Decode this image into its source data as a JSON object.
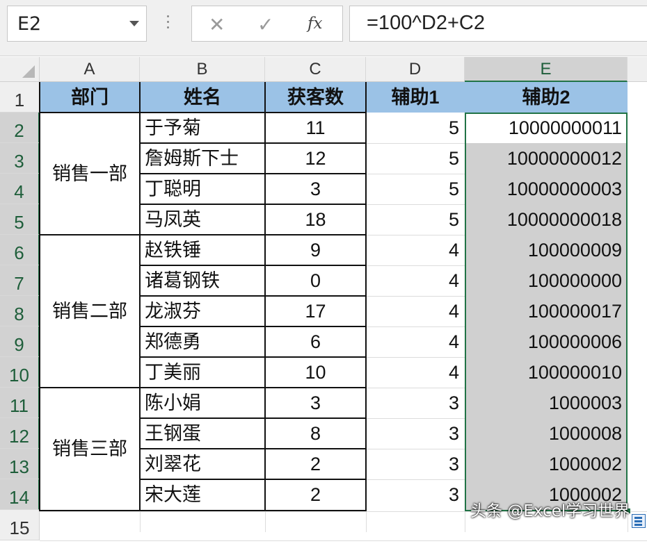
{
  "formula_bar": {
    "name_box": "E2",
    "cancel_icon": "✕",
    "confirm_icon": "✓",
    "fx_label": "fx",
    "formula": "=100^D2+C2"
  },
  "columns": [
    "A",
    "B",
    "C",
    "D",
    "E"
  ],
  "rows": [
    "1",
    "2",
    "3",
    "4",
    "5",
    "6",
    "7",
    "8",
    "9",
    "10",
    "11",
    "12",
    "13",
    "14",
    "15"
  ],
  "selected_cell": "E2",
  "headers": {
    "dept": "部门",
    "name": "姓名",
    "count": "获客数",
    "helper1": "辅助1",
    "helper2": "辅助2"
  },
  "departments": [
    "销售一部",
    "销售二部",
    "销售三部"
  ],
  "records": [
    {
      "name": "于予菊",
      "count": "11",
      "helper1": "5",
      "helper2": "10000000011"
    },
    {
      "name": "詹姆斯下士",
      "count": "12",
      "helper1": "5",
      "helper2": "10000000012"
    },
    {
      "name": "丁聪明",
      "count": "3",
      "helper1": "5",
      "helper2": "10000000003"
    },
    {
      "name": "马凤英",
      "count": "18",
      "helper1": "5",
      "helper2": "10000000018"
    },
    {
      "name": "赵铁锤",
      "count": "9",
      "helper1": "4",
      "helper2": "100000009"
    },
    {
      "name": "诸葛钢铁",
      "count": "0",
      "helper1": "4",
      "helper2": "100000000"
    },
    {
      "name": "龙淑芬",
      "count": "17",
      "helper1": "4",
      "helper2": "100000017"
    },
    {
      "name": "郑德勇",
      "count": "6",
      "helper1": "4",
      "helper2": "100000006"
    },
    {
      "name": "丁美丽",
      "count": "10",
      "helper1": "4",
      "helper2": "100000010"
    },
    {
      "name": "陈小娟",
      "count": "3",
      "helper1": "3",
      "helper2": "1000003"
    },
    {
      "name": "王钢蛋",
      "count": "8",
      "helper1": "3",
      "helper2": "1000008"
    },
    {
      "name": "刘翠花",
      "count": "2",
      "helper1": "3",
      "helper2": "1000002"
    },
    {
      "name": "宋大莲",
      "count": "2",
      "helper1": "3",
      "helper2": "1000002"
    }
  ],
  "watermark": "头条 @Excel学习世界",
  "colors": {
    "header_fill": "#9bc2e6",
    "selection_fill": "#d0d0d0",
    "selection_border": "#217346"
  }
}
